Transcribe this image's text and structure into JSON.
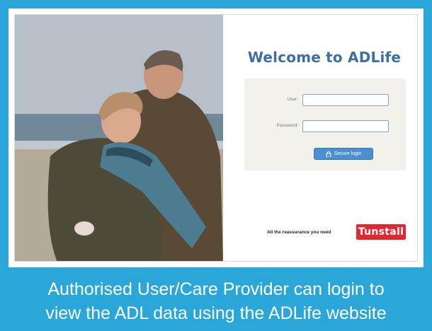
{
  "login_page": {
    "welcome_title": "Welcome to ADLife",
    "user_label": "User:",
    "user_value": "",
    "password_label": "Password:",
    "password_value": "",
    "secure_login_label": "Secure login",
    "tagline": "All the reassurance you need",
    "brand_logo_text": "Tunstall"
  },
  "caption": {
    "line1": "Authorised User/Care Provider can login to",
    "line2": "view the ADL data using the ADLife website"
  },
  "colors": {
    "frame_blue": "#2aa6d9",
    "title_blue": "#3b6fa5",
    "button_blue": "#4a8fd1",
    "brand_red": "#e3262f"
  },
  "icons": {
    "login_button_icon": "lock-icon"
  }
}
